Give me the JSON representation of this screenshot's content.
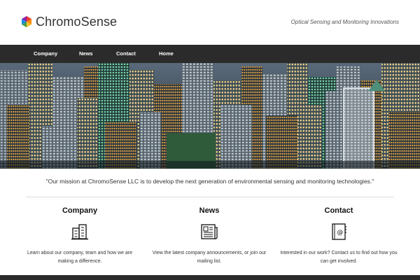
{
  "brand": {
    "name": "ChromoSense",
    "tagline": "Optical Sensing and Monitoring Innovations"
  },
  "nav": {
    "items": [
      "Company",
      "News",
      "Contact",
      "Home"
    ]
  },
  "hero": {
    "icon": "city-skyline-photo"
  },
  "mission": {
    "text": "\"Our mission at ChromoSense LLC is to develop the next generation of environmental sensing and monitoring technologies.\""
  },
  "columns": [
    {
      "title": "Company",
      "icon": "office-building-icon",
      "text": "Learn about our company, team and how we are making a difference."
    },
    {
      "title": "News",
      "icon": "newspaper-icon",
      "text": "View the latest company announcements, or join our mailing list."
    },
    {
      "title": "Contact",
      "icon": "contact-book-icon",
      "text": "Interested in our work? Contact us to find out how you can get involved."
    }
  ],
  "colors": {
    "nav_bg": "#2b2b2b",
    "nav_text": "#ffffff",
    "logo_red": "#e53935",
    "logo_yellow": "#fbc02d",
    "logo_green": "#43a047",
    "logo_blue": "#1e88e5",
    "logo_purple": "#8e24aa",
    "logo_orange": "#fb8c00"
  }
}
